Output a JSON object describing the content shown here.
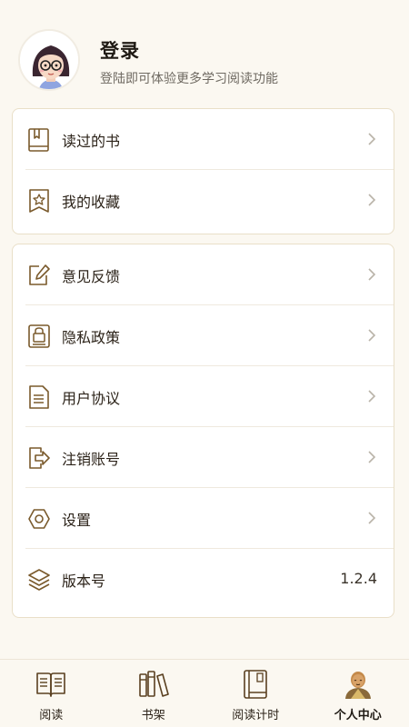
{
  "profile": {
    "title": "登录",
    "subtitle": "登陆即可体验更多学习阅读功能"
  },
  "menu_group_1": [
    {
      "label": "读过的书",
      "icon": "book-icon"
    },
    {
      "label": "我的收藏",
      "icon": "star-bookmark-icon"
    }
  ],
  "menu_group_2": [
    {
      "label": "意见反馈",
      "icon": "edit-icon"
    },
    {
      "label": "隐私政策",
      "icon": "lock-document-icon"
    },
    {
      "label": "用户协议",
      "icon": "document-icon"
    },
    {
      "label": "注销账号",
      "icon": "logout-icon"
    },
    {
      "label": "设置",
      "icon": "hexagon-settings-icon"
    },
    {
      "label": "版本号",
      "icon": "layers-icon",
      "value": "1.2.4"
    }
  ],
  "tabbar": [
    {
      "label": "阅读",
      "icon": "open-book-icon",
      "active": false
    },
    {
      "label": "书架",
      "icon": "bookshelf-icon",
      "active": false
    },
    {
      "label": "阅读计时",
      "icon": "closed-book-icon",
      "active": false
    },
    {
      "label": "个人中心",
      "icon": "monk-avatar-icon",
      "active": true
    }
  ],
  "colors": {
    "background": "#fbf8f1",
    "icon_stroke": "#7a5a2c",
    "card_border": "#e9dfc8",
    "chevron": "#b9b3a8"
  }
}
